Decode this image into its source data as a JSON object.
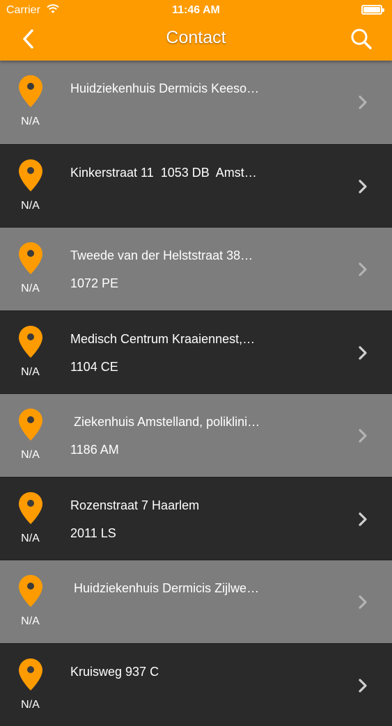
{
  "status_bar": {
    "carrier": "Carrier",
    "time": "11:46 AM"
  },
  "nav": {
    "title": "Contact",
    "back_icon": "chevron-left-icon",
    "search_icon": "search-icon"
  },
  "colors": {
    "accent": "#fe9b00",
    "row_light": "#7d7d7d",
    "row_dark": "#2a2a2b"
  },
  "contacts": [
    {
      "line1": "Huidziekenhuis Dermicis Keeso…",
      "line2": "",
      "distance": "N/A"
    },
    {
      "line1": "Kinkerstraat 11  1053 DB  Amst…",
      "line2": "",
      "distance": "N/A"
    },
    {
      "line1": "Tweede van der Helststraat 38…",
      "line2": "1072 PE",
      "distance": "N/A"
    },
    {
      "line1": "Medisch Centrum Kraaiennest,…",
      "line2": "1104 CE",
      "distance": "N/A"
    },
    {
      "line1": " Ziekenhuis Amstelland, poliklini…",
      "line2": "1186 AM",
      "distance": "N/A"
    },
    {
      "line1": "Rozenstraat 7 Haarlem",
      "line2": "2011 LS",
      "distance": "N/A"
    },
    {
      "line1": " Huidziekenhuis Dermicis Zijlwe…",
      "line2": "",
      "distance": "N/A"
    },
    {
      "line1": "Kruisweg 937 C",
      "line2": "",
      "distance": "N/A"
    }
  ]
}
